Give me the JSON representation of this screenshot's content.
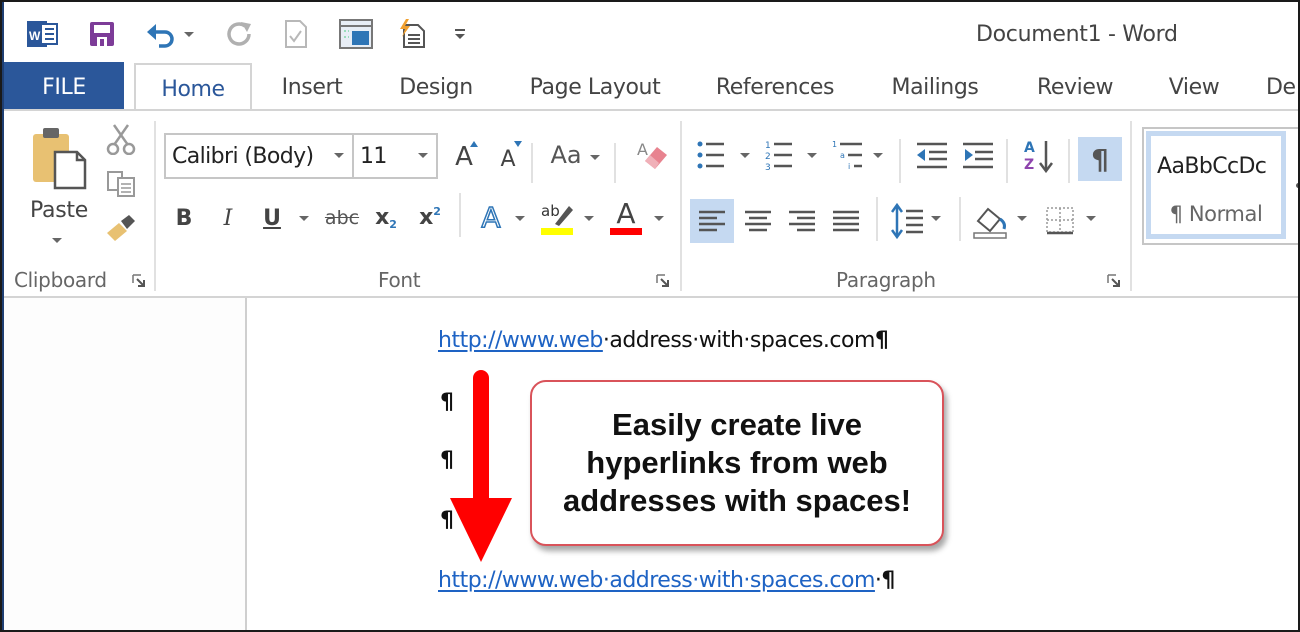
{
  "window": {
    "title": "Document1 - Word"
  },
  "qat": {
    "icons": [
      "word-logo-icon",
      "save-icon",
      "undo-icon",
      "redo-icon",
      "check-document-icon",
      "print-layout-icon",
      "quick-print-icon",
      "customize-qat-icon"
    ]
  },
  "tabs": [
    {
      "label": "FILE"
    },
    {
      "label": "Home"
    },
    {
      "label": "Insert"
    },
    {
      "label": "Design"
    },
    {
      "label": "Page Layout"
    },
    {
      "label": "References"
    },
    {
      "label": "Mailings"
    },
    {
      "label": "Review"
    },
    {
      "label": "View"
    },
    {
      "label": "De"
    }
  ],
  "ribbon": {
    "clipboard": {
      "label": "Clipboard",
      "paste_label": "Paste"
    },
    "font": {
      "label": "Font",
      "font_name": "Calibri (Body)",
      "font_size": "11",
      "change_case": "Aa",
      "bold": "B",
      "italic": "I",
      "underline": "U",
      "strikethrough": "abc",
      "subscript": "x",
      "subscript_mark": "2",
      "superscript": "x",
      "superscript_mark": "2",
      "grow": "A",
      "shrink": "A",
      "text_effects": "A",
      "highlight_text": "ab",
      "font_color": "A",
      "highlight_color": "#ffff00",
      "font_color_value": "#ff0000"
    },
    "paragraph": {
      "label": "Paragraph",
      "show_marks": "¶",
      "show_marks_active": true,
      "align_left_active": true
    },
    "styles": {
      "preview": "AaBbCcDc",
      "style_name": "¶ Normal"
    }
  },
  "document": {
    "line1_link": "http://www.web",
    "line1_rest": "·address·with·spaces.com",
    "pilcrow": "¶",
    "line2_link": "http://www.web·address·with·spaces.com",
    "line2_rest": "·",
    "callout_text": "Easily create live hyperlinks from web addresses with spaces!",
    "arrow_color": "#ff0000"
  }
}
